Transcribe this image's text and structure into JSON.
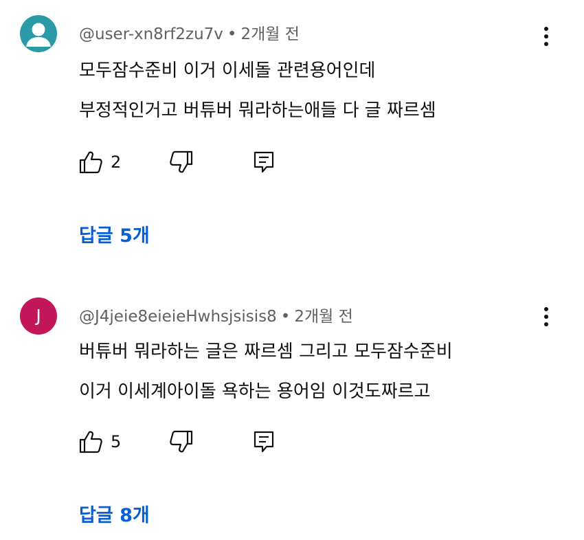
{
  "comments": [
    {
      "avatar": "default-user-icon",
      "avatar_letter": "",
      "avatar_color": "#2a9aa8",
      "username": "@user-xn8rf2zu7v",
      "separator": "•",
      "time": "2개월 전",
      "lines": [
        "모두잠수준비 이거 이세돌 관련용어인데",
        "부정적인거고 버튜버 뭐라하는애들 다 글 짜르셈"
      ],
      "likes": "2",
      "replies_label": "답글 5개"
    },
    {
      "avatar": "letter-avatar",
      "avatar_letter": "J",
      "avatar_color": "#c2185b",
      "username": "@J4jeie8eieieHwhsjsisis8",
      "separator": "•",
      "time": "2개월 전",
      "lines": [
        "버튜버 뭐라하는 글은 짜르셈 그리고 모두잠수준비",
        "이거 이세계아이돌 욕하는 용어임 이것도짜르고"
      ],
      "likes": "5",
      "replies_label": "답글 8개"
    }
  ],
  "colors": {
    "link": "#065fd4",
    "meta": "#606060",
    "text": "#0f0f0f"
  }
}
